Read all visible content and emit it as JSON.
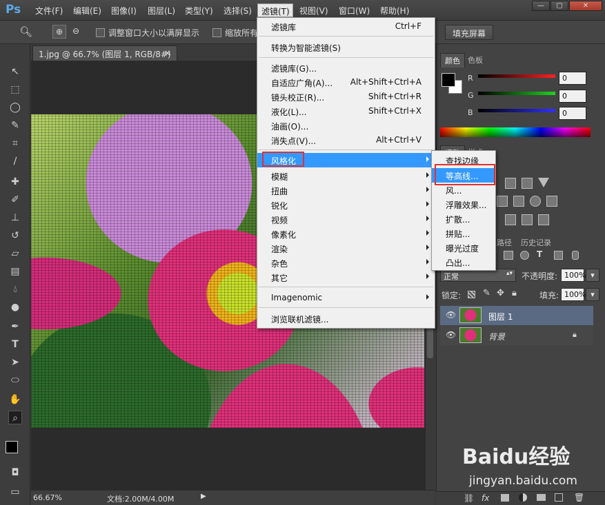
{
  "app": {
    "logo": "Ps"
  },
  "menubar": {
    "items": [
      "文件(F)",
      "编辑(E)",
      "图像(I)",
      "图层(L)",
      "类型(Y)",
      "选择(S)",
      "滤镜(T)",
      "视图(V)",
      "窗口(W)",
      "帮助(H)"
    ],
    "window_buttons": [
      "—",
      "▢",
      "✕"
    ]
  },
  "options_bar": {
    "resize_windows_label": "调整窗口大小以满屏显示",
    "zoom_all_label": "缩放所有",
    "fill_screen_button": "填充屏幕"
  },
  "document": {
    "tab_title": "1.jpg @ 66.7% (图层 1, RGB/8#) *",
    "tab_close": "×"
  },
  "status_bar": {
    "zoom": "66.67%",
    "doc_info": "文档:2.00M/4.00M"
  },
  "filter_menu": {
    "group1": [
      {
        "label": "滤镜库",
        "shortcut": "Ctrl+F"
      }
    ],
    "group2": [
      {
        "label": "转换为智能滤镜(S)",
        "shortcut": ""
      }
    ],
    "group3": [
      {
        "label": "滤镜库(G)...",
        "shortcut": ""
      },
      {
        "label": "自适应广角(A)...",
        "shortcut": "Alt+Shift+Ctrl+A"
      },
      {
        "label": "镜头校正(R)...",
        "shortcut": "Shift+Ctrl+R"
      },
      {
        "label": "液化(L)...",
        "shortcut": "Shift+Ctrl+X"
      },
      {
        "label": "油画(O)...",
        "shortcut": ""
      },
      {
        "label": "消失点(V)...",
        "shortcut": "Alt+Ctrl+V"
      }
    ],
    "submenus": [
      "风格化",
      "模糊",
      "扭曲",
      "锐化",
      "视频",
      "像素化",
      "渲染",
      "杂色",
      "其它"
    ],
    "group5": [
      {
        "label": "Imagenomic"
      }
    ],
    "group6": [
      {
        "label": "浏览联机滤镜..."
      }
    ]
  },
  "stylize_menu": {
    "items": [
      "查找边缘",
      "等高线...",
      "风...",
      "浮雕效果...",
      "扩散...",
      "拼贴...",
      "曝光过度",
      "凸出..."
    ],
    "highlighted": "等高线..."
  },
  "color_panel": {
    "tabs": [
      "颜色",
      "色板"
    ],
    "channels": [
      {
        "name": "R",
        "value": "0",
        "color": "#ff2020"
      },
      {
        "name": "G",
        "value": "0",
        "color": "#20d020"
      },
      {
        "name": "B",
        "value": "0",
        "color": "#3030ff"
      }
    ]
  },
  "adjust_panel": {
    "tabs": [
      "调整",
      "样式"
    ]
  },
  "layers_panel": {
    "tabs": [
      "路径",
      "历史记录"
    ],
    "blend_mode": "正常",
    "opacity_label": "不透明度:",
    "opacity": "100%",
    "lock_label": "锁定:",
    "fill_label": "填充:",
    "fill": "100%",
    "layers": [
      {
        "name": "图层 1",
        "selected": true
      },
      {
        "name": "背景",
        "selected": false,
        "locked": true
      }
    ],
    "bottom_icons": [
      "link-icon",
      "fx-icon",
      "mask-icon",
      "adjustment-icon",
      "folder-icon",
      "new-layer-icon",
      "trash-icon"
    ]
  },
  "watermark": {
    "brand": "Baidu经验",
    "url": "jingyan.baidu.com"
  }
}
